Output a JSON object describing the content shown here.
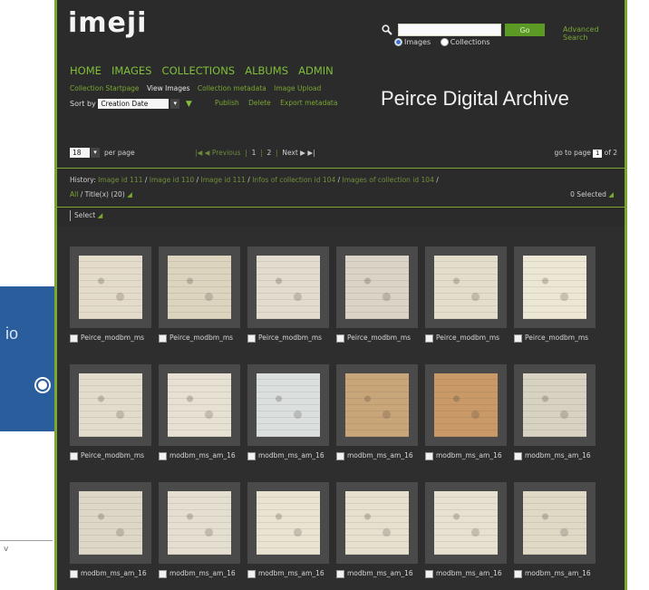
{
  "background_fragments": {
    "left_text": "io",
    "bottom_text": "v"
  },
  "app": {
    "logo": "imeji",
    "title": "Peirce Digital Archive"
  },
  "search": {
    "go_label": "Go",
    "advanced_label": "Advanced Search",
    "radio_images": "Images",
    "radio_collections": "Collections"
  },
  "main_nav": [
    "HOME",
    "IMAGES",
    "COLLECTIONS",
    "ALBUMS",
    "ADMIN"
  ],
  "sub_nav": {
    "startpage": "Collection Startpage",
    "view_images": "View Images",
    "metadata": "Collection metadata",
    "upload": "Image Upload"
  },
  "sort": {
    "label": "Sort by",
    "value": "Creation Date"
  },
  "actions": {
    "publish": "Publish",
    "delete": "Delete",
    "export": "Export metadata"
  },
  "pager": {
    "per_page_value": "18",
    "per_page_label": "per page",
    "first_prev": "|◀ ◀  Previous",
    "page1": "1",
    "page2": "2",
    "next_last": "Next ▶ ▶|",
    "goto_label": "go to page",
    "goto_value": "1",
    "goto_of": "of 2"
  },
  "history": {
    "label": "History:",
    "items": [
      "Image id 111",
      "Image id 110",
      "Image id 111",
      "Infos of collection id 104",
      "Images of collection id 104"
    ]
  },
  "filter": {
    "all": "All",
    "title_facet": "/ Title(x) (20)"
  },
  "selected": "0 Selected",
  "select_label": "Select",
  "images": [
    {
      "caption": "Peirce_modbm_ms",
      "tone": "#e4dccb"
    },
    {
      "caption": "Peirce_modbm_ms",
      "tone": "#ddd4bf"
    },
    {
      "caption": "Peirce_modbm_ms",
      "tone": "#e1dccd"
    },
    {
      "caption": "Peirce_modbm_ms",
      "tone": "#d9d4c5"
    },
    {
      "caption": "Peirce_modbm_ms",
      "tone": "#e3ddcc"
    },
    {
      "caption": "Peirce_modbm_ms",
      "tone": "#ece6d5"
    },
    {
      "caption": "Peirce_modbm_ms",
      "tone": "#e2dccc"
    },
    {
      "caption": "modbm_ms_am_16",
      "tone": "#e6e1d3"
    },
    {
      "caption": "modbm_ms_am_16",
      "tone": "#dbe0df"
    },
    {
      "caption": "modbm_ms_am_16",
      "tone": "#c9a57a"
    },
    {
      "caption": "modbm_ms_am_16",
      "tone": "#c99a68"
    },
    {
      "caption": "modbm_ms_am_16",
      "tone": "#d8d2c2"
    },
    {
      "caption": "modbm_ms_am_16",
      "tone": "#ddd7c7"
    },
    {
      "caption": "modbm_ms_am_16",
      "tone": "#e4dfd0"
    },
    {
      "caption": "modbm_ms_am_16",
      "tone": "#e9e3d2"
    },
    {
      "caption": "modbm_ms_am_16",
      "tone": "#e6e0cf"
    },
    {
      "caption": "modbm_ms_am_16",
      "tone": "#e7e1d1"
    },
    {
      "caption": "modbm_ms_am_16",
      "tone": "#e0d9c6"
    }
  ]
}
